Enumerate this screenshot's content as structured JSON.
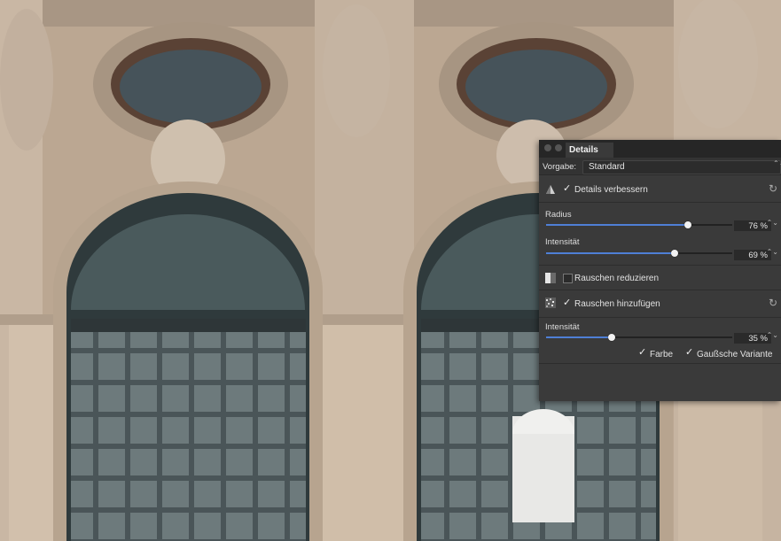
{
  "panel": {
    "tab_title": "Details",
    "preset": {
      "label": "Vorgabe:",
      "value": "Standard"
    },
    "details_section": {
      "checked": true,
      "label": "Details verbessern"
    },
    "radius": {
      "label": "Radius",
      "value_text": "76 %",
      "value": 0.76
    },
    "intensity1": {
      "label": "Intensität",
      "value_text": "69 %",
      "value": 0.69
    },
    "noise_reduce": {
      "checked": false,
      "label": "Rauschen reduzieren"
    },
    "noise_add": {
      "checked": true,
      "label": "Rauschen hinzufügen"
    },
    "intensity2": {
      "label": "Intensität",
      "value_text": "35 %",
      "value": 0.35
    },
    "option_color": {
      "checked": true,
      "label": "Farbe"
    },
    "option_gauss": {
      "checked": true,
      "label": "Gaußsche Variante"
    }
  },
  "glyphs": {
    "check": "✓",
    "reset": "↻",
    "stepper": "⌃⌄"
  },
  "colors": {
    "accent": "#4f7fd6",
    "panel_bg": "#3a3a3a"
  }
}
